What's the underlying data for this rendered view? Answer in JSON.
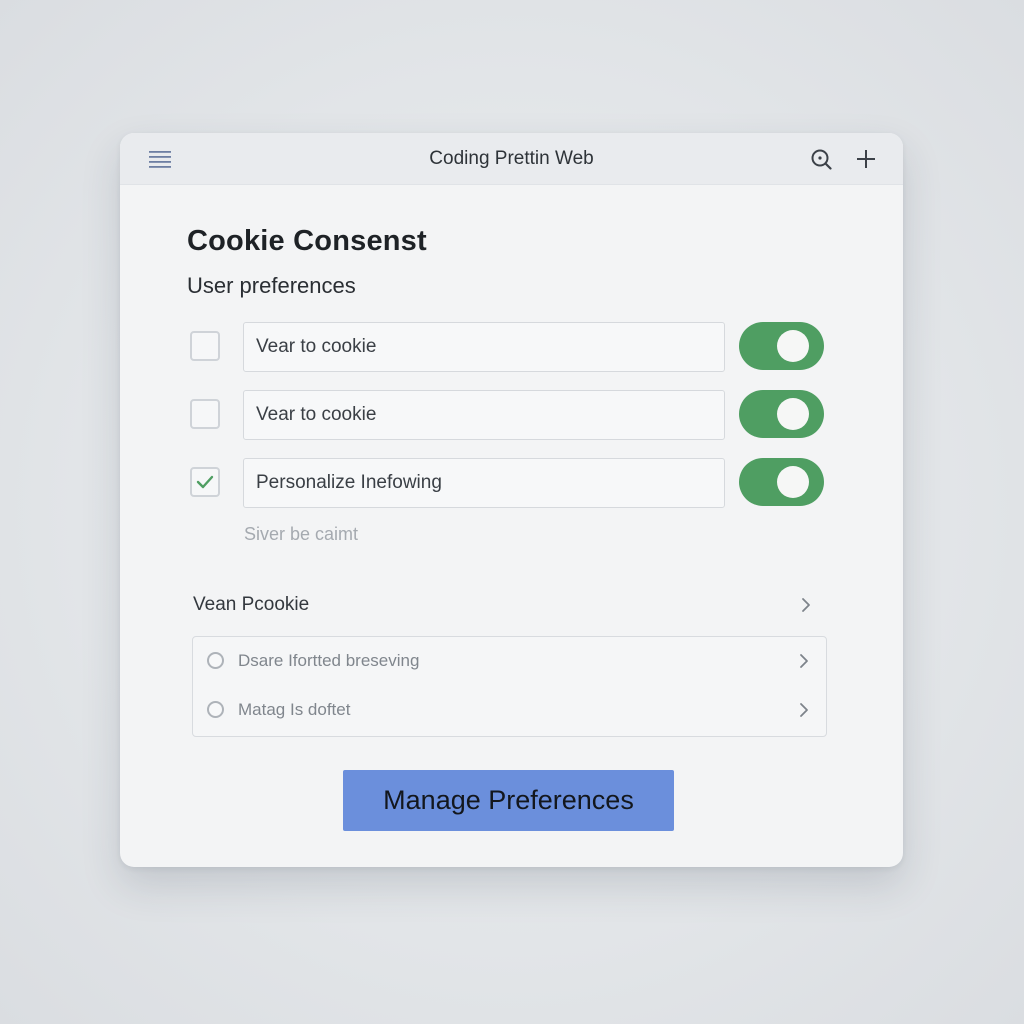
{
  "window": {
    "title": "Coding Prettin Web"
  },
  "icons": {
    "menu": "hamburger-menu-icon",
    "search": "search-icon",
    "add": "plus-icon"
  },
  "content": {
    "heading": "Cookie Consenst",
    "subheading": "User preferences",
    "preferences": [
      {
        "label": "Vear to cookie",
        "checked": false,
        "toggle_on": true
      },
      {
        "label": "Vear to cookie",
        "checked": false,
        "toggle_on": true
      },
      {
        "label": "Personalize Inefowing",
        "checked": true,
        "toggle_on": true
      }
    ],
    "helper_text": "Siver be caimt",
    "section": {
      "label": "Vean Pcookie",
      "options": [
        {
          "label": "Dsare Ifortted breseving",
          "selected": false
        },
        {
          "label": "Matag Is doftet",
          "selected": false
        }
      ]
    },
    "primary_button": "Manage Preferences"
  },
  "colors": {
    "accent_green": "#4f9e62",
    "button_blue": "#6b8fdc",
    "check_green": "#4f9e62"
  }
}
